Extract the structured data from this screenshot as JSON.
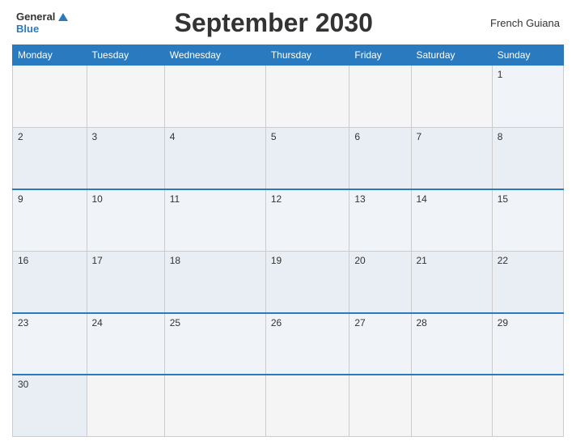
{
  "header": {
    "logo_general": "General",
    "logo_blue": "Blue",
    "title": "September 2030",
    "region": "French Guiana"
  },
  "columns": [
    "Monday",
    "Tuesday",
    "Wednesday",
    "Thursday",
    "Friday",
    "Saturday",
    "Sunday"
  ],
  "weeks": [
    [
      {
        "day": "",
        "empty": true
      },
      {
        "day": "",
        "empty": true
      },
      {
        "day": "",
        "empty": true
      },
      {
        "day": "",
        "empty": true
      },
      {
        "day": "",
        "empty": true
      },
      {
        "day": "",
        "empty": true
      },
      {
        "day": "1"
      }
    ],
    [
      {
        "day": "2"
      },
      {
        "day": "3"
      },
      {
        "day": "4"
      },
      {
        "day": "5"
      },
      {
        "day": "6"
      },
      {
        "day": "7"
      },
      {
        "day": "8"
      }
    ],
    [
      {
        "day": "9"
      },
      {
        "day": "10"
      },
      {
        "day": "11"
      },
      {
        "day": "12"
      },
      {
        "day": "13"
      },
      {
        "day": "14"
      },
      {
        "day": "15"
      }
    ],
    [
      {
        "day": "16"
      },
      {
        "day": "17"
      },
      {
        "day": "18"
      },
      {
        "day": "19"
      },
      {
        "day": "20"
      },
      {
        "day": "21"
      },
      {
        "day": "22"
      }
    ],
    [
      {
        "day": "23"
      },
      {
        "day": "24"
      },
      {
        "day": "25"
      },
      {
        "day": "26"
      },
      {
        "day": "27"
      },
      {
        "day": "28"
      },
      {
        "day": "29"
      }
    ],
    [
      {
        "day": "30"
      },
      {
        "day": "",
        "empty": true
      },
      {
        "day": "",
        "empty": true
      },
      {
        "day": "",
        "empty": true
      },
      {
        "day": "",
        "empty": true
      },
      {
        "day": "",
        "empty": true
      },
      {
        "day": "",
        "empty": true
      }
    ]
  ]
}
